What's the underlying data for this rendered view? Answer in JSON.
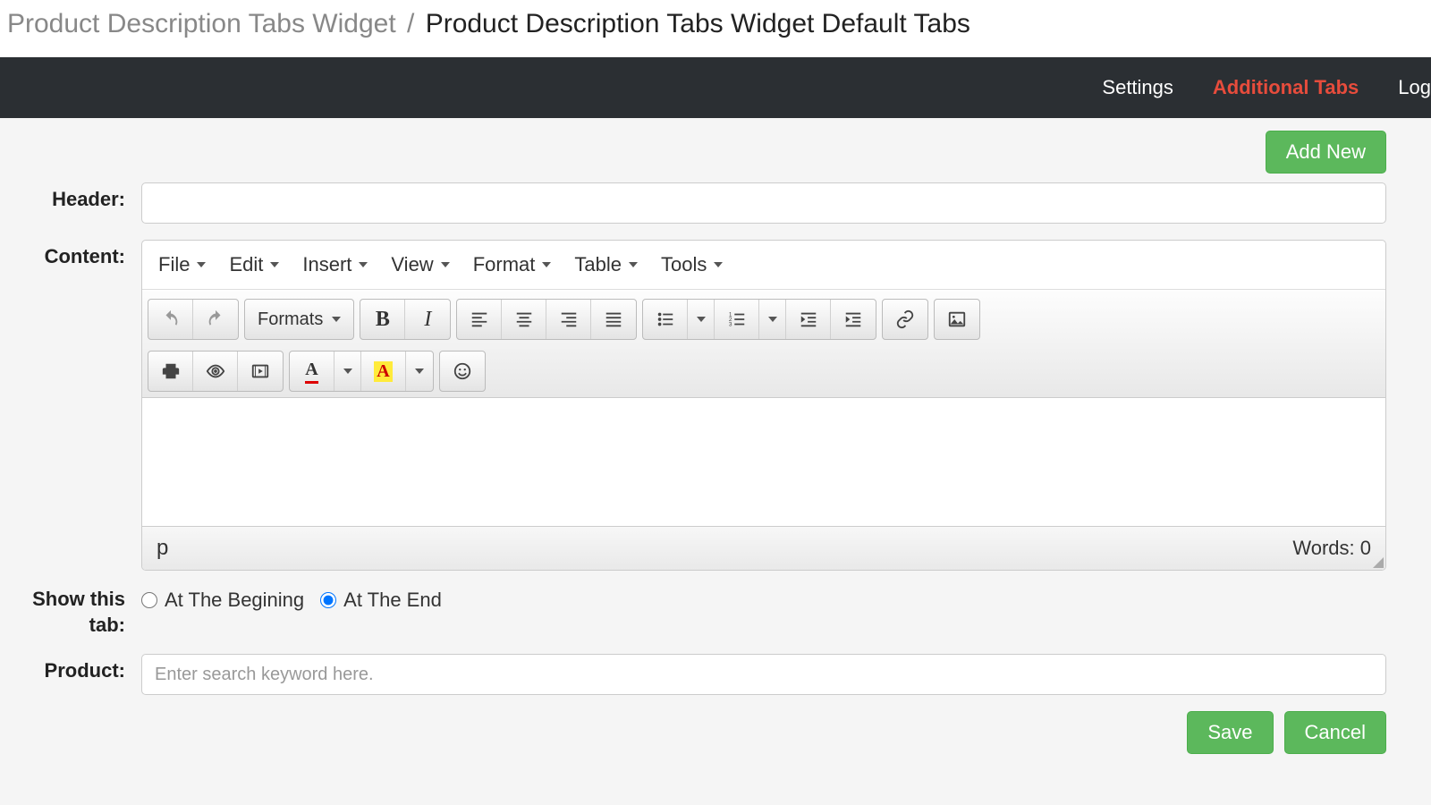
{
  "breadcrumb": {
    "parent": "Product Description Tabs Widget",
    "sep": "/",
    "current": "Product Description Tabs Widget Default Tabs"
  },
  "navbar": {
    "settings": "Settings",
    "additional_tabs": "Additional Tabs",
    "log": "Log"
  },
  "buttons": {
    "add_new": "Add New",
    "save": "Save",
    "cancel": "Cancel"
  },
  "labels": {
    "header": "Header:",
    "content": "Content:",
    "show_tab": "Show this tab:",
    "product": "Product:"
  },
  "editor": {
    "menus": {
      "file": "File",
      "edit": "Edit",
      "insert": "Insert",
      "view": "View",
      "format": "Format",
      "table": "Table",
      "tools": "Tools"
    },
    "formats_label": "Formats",
    "status_path": "p",
    "words_label": "Words: 0"
  },
  "radios": {
    "begin": "At The Begining",
    "end": "At The End"
  },
  "product_placeholder": "Enter search keyword here."
}
